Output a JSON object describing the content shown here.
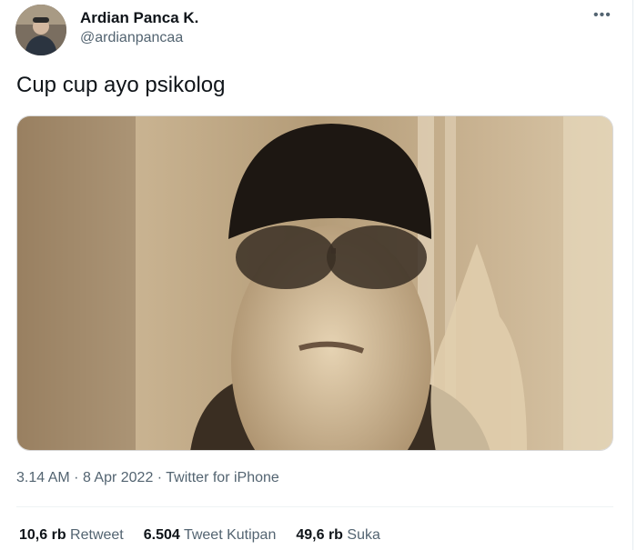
{
  "user": {
    "name": "Ardian Panca K.",
    "handle": "@ardianpancaa"
  },
  "tweet": {
    "text": "Cup cup ayo psikolog",
    "time": "3.14 AM",
    "date": "8 Apr 2022",
    "source": "Twitter for iPhone",
    "separator": "·"
  },
  "stats": [
    {
      "value": "10,6 rb",
      "label": "Retweet"
    },
    {
      "value": "6.504",
      "label": "Tweet Kutipan"
    },
    {
      "value": "49,6 rb",
      "label": "Suka"
    }
  ],
  "icons": {
    "more": "more-horizontal-icon"
  },
  "colors": {
    "text": "#0f1419",
    "secondary": "#536471",
    "media_tint": "#b9a27c"
  }
}
